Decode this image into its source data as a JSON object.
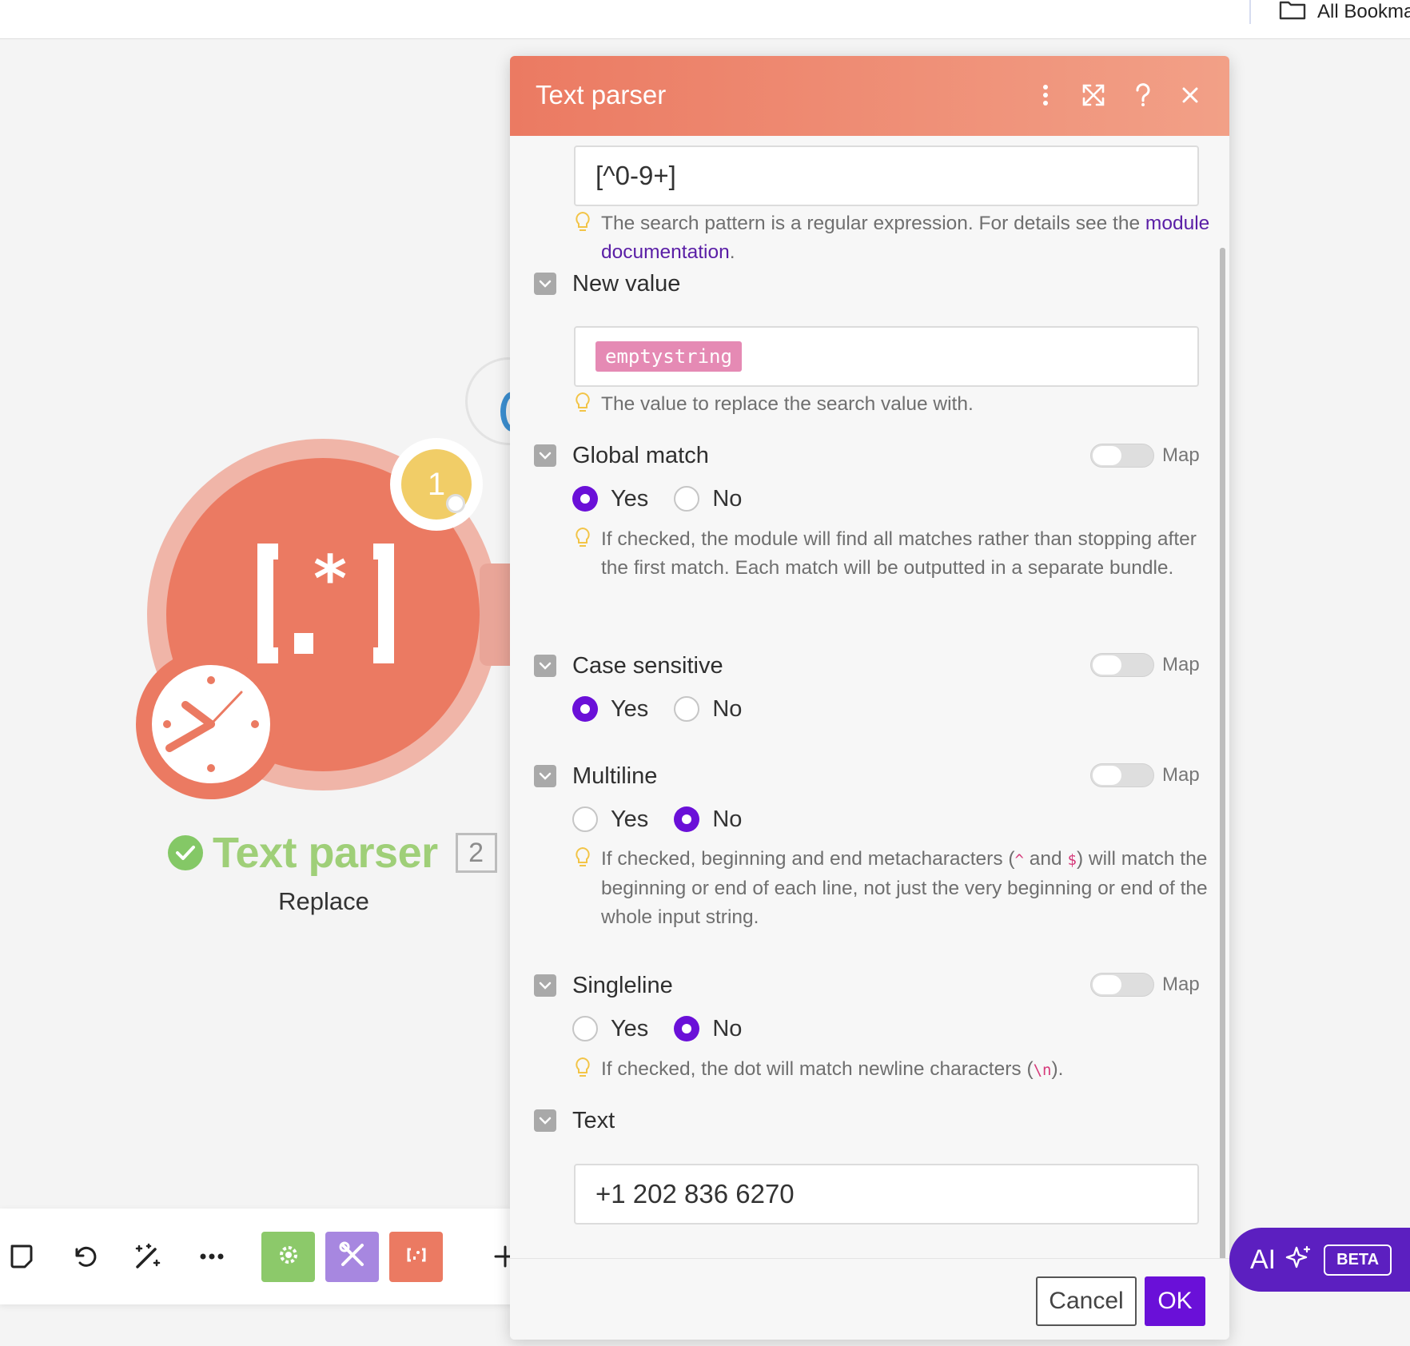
{
  "browser": {
    "bookmarks_label": "All Bookmarks"
  },
  "module": {
    "name": "Text parser",
    "id": "2",
    "action": "Replace",
    "badge_count": "1",
    "glyph": "(.*)"
  },
  "dialog": {
    "title": "Text parser",
    "pattern": {
      "value": "[^0-9+]",
      "hint_text": "The search pattern is a regular expression. For details see the ",
      "hint_link": "module documentation",
      "hint_end": "."
    },
    "new_value": {
      "label": "New value",
      "pill": "emptystring",
      "hint": "The value to replace the search value with."
    },
    "global_match": {
      "label": "Global match",
      "map_label": "Map",
      "yes": "Yes",
      "no": "No",
      "hint": "If checked, the module will find all matches rather than stopping after the first match. Each match will be outputted in a separate bundle."
    },
    "case_sensitive": {
      "label": "Case sensitive",
      "map_label": "Map",
      "yes": "Yes",
      "no": "No"
    },
    "multiline": {
      "label": "Multiline",
      "map_label": "Map",
      "yes": "Yes",
      "no": "No",
      "hint_a": "If checked, beginning and end metacharacters (",
      "code_caret": "^",
      "hint_b": " and ",
      "code_dollar": "$",
      "hint_c": ") will match the beginning or end of each line, not just the very beginning or end of the whole input string."
    },
    "singleline": {
      "label": "Singleline",
      "map_label": "Map",
      "yes": "Yes",
      "no": "No",
      "hint_a": "If checked, the dot will match newline characters (",
      "code_newline": "\\n",
      "hint_b": ")."
    },
    "text": {
      "label": "Text",
      "value": "+1 202 836 6270"
    },
    "cancel_label": "Cancel",
    "ok_label": "OK"
  },
  "ai": {
    "label": "AI",
    "beta": "BETA"
  },
  "colors": {
    "accent": "#6a10d8",
    "module": "#eb7a62",
    "success": "#84c866",
    "pill": "#e58ab4"
  }
}
